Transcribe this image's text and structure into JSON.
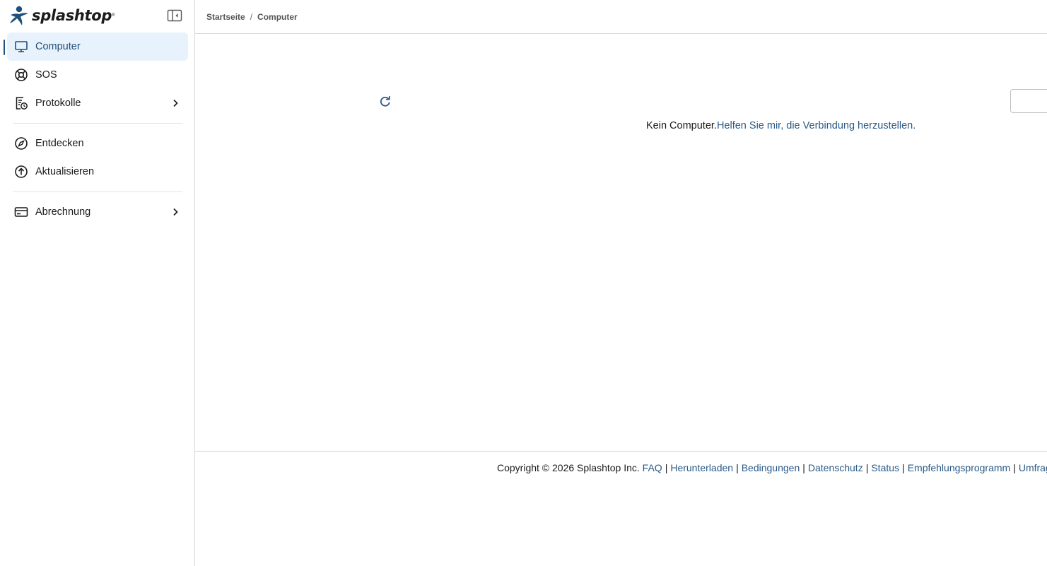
{
  "brand": {
    "name": "splashtop",
    "mark": "®",
    "accent": "#1f4f7a",
    "link_color": "#2a5a86"
  },
  "sidebar": {
    "items": [
      {
        "label": "Computer",
        "icon": "monitor-icon",
        "active": true
      },
      {
        "label": "SOS",
        "icon": "lifebuoy-icon"
      },
      {
        "label": "Protokolle",
        "icon": "log-clock-icon",
        "has_submenu": true
      },
      {
        "label": "Entdecken",
        "icon": "compass-icon"
      },
      {
        "label": "Aktualisieren",
        "icon": "upload-circle-icon"
      },
      {
        "label": "Abrechnung",
        "icon": "credit-card-icon",
        "has_submenu": true
      }
    ]
  },
  "breadcrumb": {
    "home": "Startseite",
    "separator": "/",
    "current": "Computer"
  },
  "main": {
    "empty_text": "Kein Computer.",
    "help_link": "Helfen Sie mir, die Verbindung herzustellen.",
    "search_value": ""
  },
  "footer": {
    "copyright": "Copyright © 2026 Splashtop Inc.",
    "links": [
      "FAQ",
      "Herunterladen",
      "Bedingungen",
      "Datenschutz",
      "Status",
      "Empfehlungsprogramm",
      "Umfrage"
    ]
  }
}
